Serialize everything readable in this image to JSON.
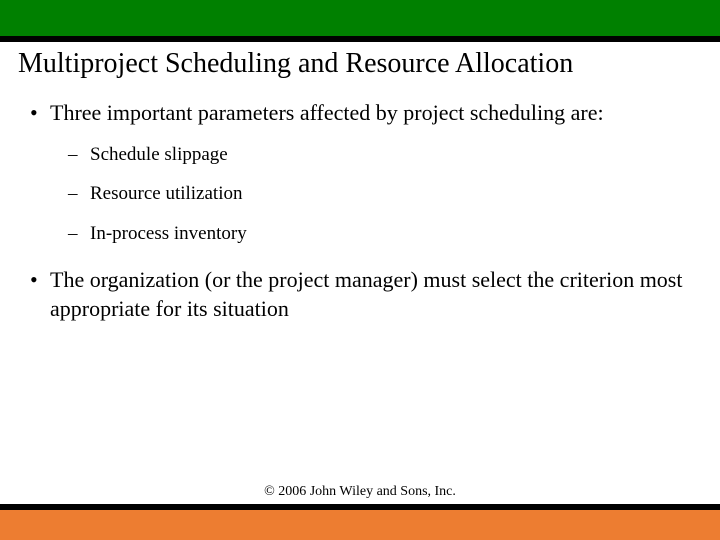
{
  "title": "Multiproject Scheduling and Resource Allocation",
  "bullets": {
    "b1": "Three important parameters affected by project scheduling are:",
    "sub1": "Schedule slippage",
    "sub2": "Resource utilization",
    "sub3": "In-process inventory",
    "b2": "The organization (or the project manager) must select the criterion most appropriate for its situation"
  },
  "copyright": "© 2006 John Wiley and Sons, Inc.",
  "colors": {
    "topBar": "#008000",
    "bottomBar": "#ed7d31",
    "strip": "#000000"
  }
}
